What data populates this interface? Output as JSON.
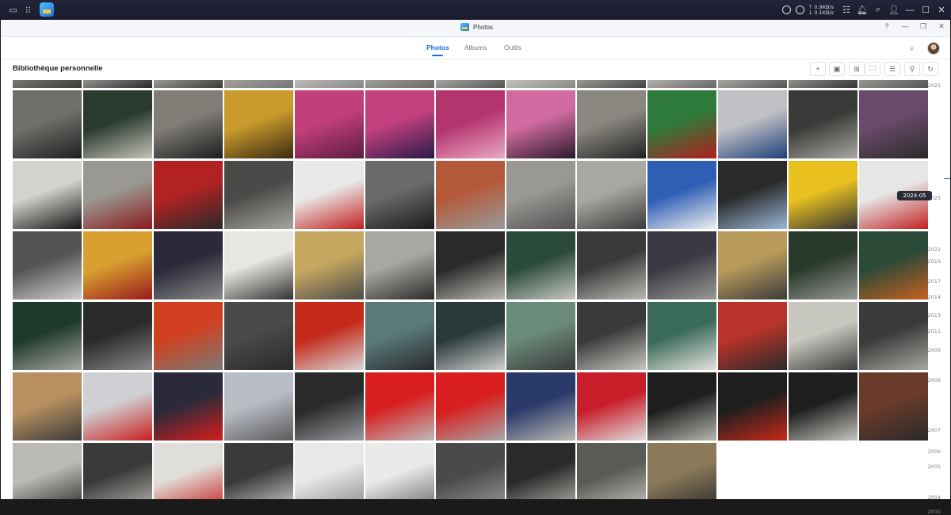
{
  "window": {
    "title": "Photos"
  },
  "taskbar": {
    "net_up": "0.9KB/s",
    "net_down": "0.1KB/s"
  },
  "tabs": [
    {
      "label": "Photos",
      "active": true
    },
    {
      "label": "Albums",
      "active": false
    },
    {
      "label": "Outils",
      "active": false
    }
  ],
  "library": {
    "title": "Bibliothèque personnelle"
  },
  "toolbar": [
    "add-icon",
    "select-icon",
    "grid-view-icon",
    "folder-icon",
    "list-view-icon",
    "filter-icon",
    "refresh-icon"
  ],
  "timeline": {
    "current": "2024-05",
    "years": [
      "2025",
      "2023",
      "2022",
      "2019",
      "2017",
      "2014",
      "2013",
      "2011",
      "2009",
      "2008",
      "2007",
      "2006",
      "2005",
      "2004",
      "2000"
    ]
  },
  "accent_color": "#1e6fd9",
  "photos": [
    {
      "c1": "#9a9a96",
      "c2": "#3a3a38"
    },
    {
      "c1": "#c9c9c4",
      "c2": "#2a2a2a"
    },
    {
      "c1": "#cfcfc8",
      "c2": "#3a3a36"
    },
    {
      "c1": "#b9b6b0",
      "c2": "#777"
    },
    {
      "c1": "#d8d6d0",
      "c2": "#888"
    },
    {
      "c1": "#bcb9b3",
      "c2": "#6a6a66"
    },
    {
      "c1": "#d2d0ca",
      "c2": "#555"
    },
    {
      "c1": "#e0ded8",
      "c2": "#8a8a86"
    },
    {
      "c1": "#cac7c0",
      "c2": "#444"
    },
    {
      "c1": "#dbd9d4",
      "c2": "#666"
    },
    {
      "c1": "#d6d4ce",
      "c2": "#555"
    },
    {
      "c1": "#c6c3bd",
      "c2": "#333"
    },
    {
      "c1": "#bdbab4",
      "c2": "#555"
    },
    {
      "c1": "#6f6f6b",
      "c2": "#1f1f1f"
    },
    {
      "c1": "#2a3a2f",
      "c2": "#c7c3b8"
    },
    {
      "c1": "#807d77",
      "c2": "#1c1c1c"
    },
    {
      "c1": "#c99a2c",
      "c2": "#3a2a10"
    },
    {
      "c1": "#c23f7a",
      "c2": "#5a1c3e"
    },
    {
      "c1": "#c2407e",
      "c2": "#2a1a4a"
    },
    {
      "c1": "#b4346e",
      "c2": "#e9a8c5"
    },
    {
      "c1": "#d06aa0",
      "c2": "#2a1a2a"
    },
    {
      "c1": "#8a8780",
      "c2": "#222"
    },
    {
      "c1": "#2e7a3a",
      "c2": "#b21f1f"
    },
    {
      "c1": "#c0c0c4",
      "c2": "#1e3e7a"
    },
    {
      "c1": "#3a3a38",
      "c2": "#a9a7a2"
    },
    {
      "c1": "#6a4a6a",
      "c2": "#2a2a2a"
    },
    {
      "c1": "#d4d2cc",
      "c2": "#151515"
    },
    {
      "c1": "#9a9892",
      "c2": "#8a1a1a"
    },
    {
      "c1": "#b22222",
      "c2": "#2a2a2a"
    },
    {
      "c1": "#4a4a48",
      "c2": "#a8a6a0"
    },
    {
      "c1": "#e8e8e8",
      "c2": "#c41e1e"
    },
    {
      "c1": "#6a6a68",
      "c2": "#1a1a1a"
    },
    {
      "c1": "#b45a3a",
      "c2": "#9a9a9a"
    },
    {
      "c1": "#9a9894",
      "c2": "#505050"
    },
    {
      "c1": "#a9a7a2",
      "c2": "#3a3a3a"
    },
    {
      "c1": "#2f5fb5",
      "c2": "#f0f0f0"
    },
    {
      "c1": "#2a2a2a",
      "c2": "#9ab8d8"
    },
    {
      "c1": "#e8c020",
      "c2": "#333"
    },
    {
      "c1": "#e6e6e6",
      "c2": "#c22020"
    },
    {
      "c1": "#545452",
      "c2": "#d0d0d0"
    },
    {
      "c1": "#d8a030",
      "c2": "#9a1a1a"
    },
    {
      "c1": "#2a2a3a",
      "c2": "#8a8a8a"
    },
    {
      "c1": "#e8e6e0",
      "c2": "#333"
    },
    {
      "c1": "#c8a860",
      "c2": "#4a4a48"
    },
    {
      "c1": "#a9a7a1",
      "c2": "#2a2a2a"
    },
    {
      "c1": "#2a2a2a",
      "c2": "#bdbbb5"
    },
    {
      "c1": "#2a4a3a",
      "c2": "#c8c8c0"
    },
    {
      "c1": "#3a3a3a",
      "c2": "#bcbab4"
    },
    {
      "c1": "#3a3a44",
      "c2": "#9a9a96"
    },
    {
      "c1": "#b89a5a",
      "c2": "#3a3a3a"
    },
    {
      "c1": "#2a3a2a",
      "c2": "#9a9a9a"
    },
    {
      "c1": "#2c4a38",
      "c2": "#c86020"
    },
    {
      "c1": "#1e3a2a",
      "c2": "#a8a6a0"
    },
    {
      "c1": "#2a2a2a",
      "c2": "#8a8a8a"
    },
    {
      "c1": "#d04020",
      "c2": "#7a7a76"
    },
    {
      "c1": "#4a4a4a",
      "c2": "#2a2a2a"
    },
    {
      "c1": "#c42a1a",
      "c2": "#d8d8d8"
    },
    {
      "c1": "#5a7a7a",
      "c2": "#2a2a2a"
    },
    {
      "c1": "#2a3a3a",
      "c2": "#d0d0d0"
    },
    {
      "c1": "#6a8a7a",
      "c2": "#3a3a3a"
    },
    {
      "c1": "#3a3a3a",
      "c2": "#c8c6c0"
    },
    {
      "c1": "#3a6a5a",
      "c2": "#e6e4de"
    },
    {
      "c1": "#b8342a",
      "c2": "#2a2a2a"
    },
    {
      "c1": "#c8c8c0",
      "c2": "#3a3a3a"
    },
    {
      "c1": "#3a3a3a",
      "c2": "#a8a6a0"
    },
    {
      "c1": "#b89060",
      "c2": "#3a3a3a"
    },
    {
      "c1": "#d0d0d4",
      "c2": "#c81e1e"
    },
    {
      "c1": "#2a2a3a",
      "c2": "#d81e1e"
    },
    {
      "c1": "#b8bcc4",
      "c2": "#5a5a5a"
    },
    {
      "c1": "#2a2a2a",
      "c2": "#9a9aa0"
    },
    {
      "c1": "#d81e1e",
      "c2": "#bcbcbc"
    },
    {
      "c1": "#d81e1e",
      "c2": "#a8a8a8"
    },
    {
      "c1": "#2a3a6a",
      "c2": "#bcbab4"
    },
    {
      "c1": "#c81e2a",
      "c2": "#e0e0e0"
    },
    {
      "c1": "#1e1e1e",
      "c2": "#b8b8b0"
    },
    {
      "c1": "#1e1e1e",
      "c2": "#c82a1a"
    },
    {
      "c1": "#1e1e1e",
      "c2": "#c8c6c0"
    },
    {
      "c1": "#6a3a2a",
      "c2": "#2a2a2a"
    },
    {
      "c1": "#bcbab4",
      "c2": "#2a2a2a"
    },
    {
      "c1": "#3a3a3a",
      "c2": "#b8b6b0"
    },
    {
      "c1": "#e0ded8",
      "c2": "#c81e1e"
    },
    {
      "c1": "#3a3a3a",
      "c2": "#d0d0d0"
    },
    {
      "c1": "#e8e8e8",
      "c2": "#8a8a8a"
    },
    {
      "c1": "#eaeaea",
      "c2": "#6a6a6a"
    },
    {
      "c1": "#4a4a4a",
      "c2": "#9a9a9a"
    },
    {
      "c1": "#2a2a2a",
      "c2": "#b8b6b0"
    },
    {
      "c1": "#5a5a56",
      "c2": "#cac8c2"
    },
    {
      "c1": "#8a7a5a",
      "c2": "#2a2a2a"
    }
  ]
}
